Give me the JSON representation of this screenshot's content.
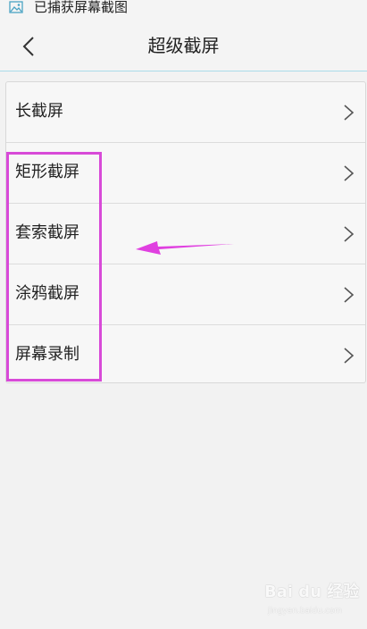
{
  "status_bar": {
    "notification_icon": "image-icon",
    "notification_text": "已捕获屏幕截图"
  },
  "header": {
    "back_icon": "chevron-left-icon",
    "title": "超级截屏"
  },
  "menu": {
    "items": [
      {
        "label": "长截屏",
        "icon": "chevron-right-icon"
      },
      {
        "label": "矩形截屏",
        "icon": "chevron-right-icon"
      },
      {
        "label": "套索截屏",
        "icon": "chevron-right-icon"
      },
      {
        "label": "涂鸦截屏",
        "icon": "chevron-right-icon"
      },
      {
        "label": "屏幕录制",
        "icon": "chevron-right-icon"
      }
    ]
  },
  "annotation": {
    "color": "#d84ad8"
  },
  "watermark": {
    "logo": "Bai du 经验",
    "url": "jingyan.baidu.com"
  }
}
